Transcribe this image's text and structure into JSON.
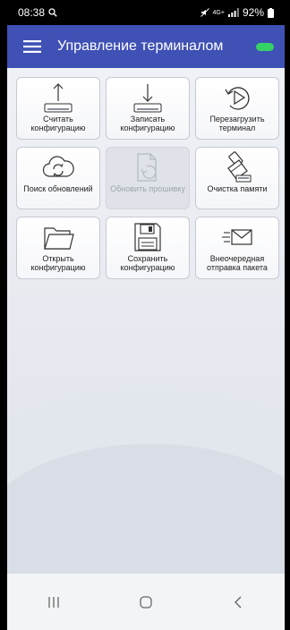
{
  "status": {
    "time": "08:38",
    "battery": "92%",
    "network": "4G+"
  },
  "appbar": {
    "title": "Управление терминалом"
  },
  "tiles": [
    {
      "label": "Считать конфигурацию",
      "icon": "upload-icon",
      "enabled": true
    },
    {
      "label": "Записать конфигурацию",
      "icon": "download-icon",
      "enabled": true
    },
    {
      "label": "Перезагрузить терминал",
      "icon": "restart-icon",
      "enabled": true
    },
    {
      "label": "Поиск обновлений",
      "icon": "cloud-refresh-icon",
      "enabled": true
    },
    {
      "label": "Обновить прошивку",
      "icon": "firmware-update-icon",
      "enabled": false
    },
    {
      "label": "Очистка памяти",
      "icon": "broom-icon",
      "enabled": true
    },
    {
      "label": "Открыть конфигурацию",
      "icon": "folder-icon",
      "enabled": true
    },
    {
      "label": "Сохранить конфигурацию",
      "icon": "floppy-disk-icon",
      "enabled": true
    },
    {
      "label": "Внеочередная отправка пакета",
      "icon": "send-mail-icon",
      "enabled": true
    }
  ],
  "colors": {
    "appbar": "#3f51b5",
    "connected_indicator": "#35d266"
  }
}
